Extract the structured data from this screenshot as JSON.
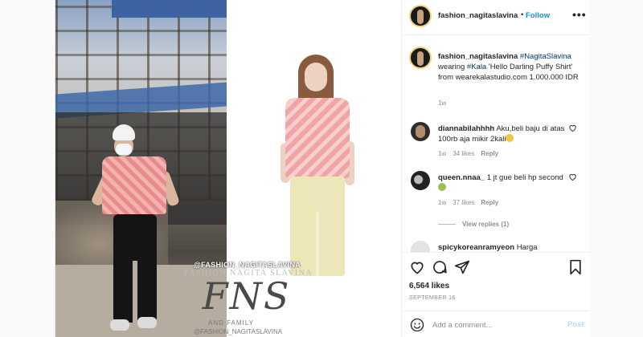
{
  "colors": {
    "follow_blue": "#0095f6",
    "hashtag": "#00376b",
    "muted": "#8e8e8e",
    "post_disabled": "#b3dbff"
  },
  "media": {
    "watermark_handle": "@FASHION_NAGITASLAVINA",
    "watermark_name": "FASHION NAGITA SLAVINA",
    "watermark_logo": "FNS",
    "watermark_family": "AND FAMILY",
    "watermark_handle_bottom": "@FASHION_NAGITASLAVINA"
  },
  "header": {
    "username": "fashion_nagitaslavina",
    "dot": "•",
    "follow_label": "Follow",
    "more_icon": "more-horizontal-icon"
  },
  "caption": {
    "username": "fashion_nagitaslavina",
    "hashtag": "#NagitaSlavina",
    "text_1": "wearing",
    "hashtag_2": "#Kala",
    "text_2": "'Hello Darling Puffy Shirt' from wearekalastudio.com 1.000.000 IDR",
    "time": "1w"
  },
  "comments": [
    {
      "username": "diannabilahhhh",
      "text": "Aku,beli baju di atas 100rb aja mikir 2kali",
      "emoji": "sweat-emoji",
      "time": "1w",
      "likes": "34 likes",
      "reply": "Reply"
    },
    {
      "username": "queen.nnaa_",
      "text": "1 jt gue beli hp second",
      "emoji": "grin-emoji",
      "time": "1w",
      "likes": "37 likes",
      "reply": "Reply"
    },
    {
      "username": "spicykoreanramyeon",
      "text": "Harga"
    }
  ],
  "view_replies": "View replies (1)",
  "actions": {
    "likes": "6,564 likes",
    "date": "SEPTEMBER 16",
    "icons": [
      "heart-icon",
      "comment-icon",
      "share-icon",
      "bookmark-icon"
    ]
  },
  "add_comment": {
    "placeholder": "Add a comment...",
    "post_label": "Post"
  }
}
